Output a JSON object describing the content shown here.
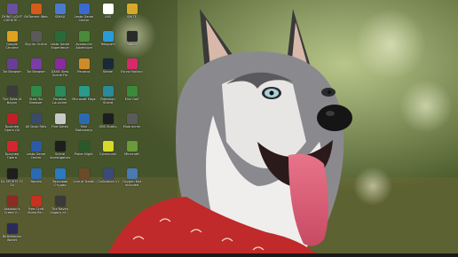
{
  "desktop": {
    "icons": [
      {
        "label": "DYING LIGHT CHRISTE...",
        "icon": "game-icon",
        "color": "#6a4fa0"
      },
      {
        "label": "Google Chrome",
        "icon": "chrome-icon",
        "color": "#e0a020"
      },
      {
        "label": "Tor Browser",
        "icon": "tor-icon",
        "color": "#6b3d99"
      },
      {
        "label": "The Tales of Bayon",
        "icon": "game-icon",
        "color": "#3c3c3c"
      },
      {
        "label": "Браузер Opera GX",
        "icon": "opera-icon",
        "color": "#c0202a"
      },
      {
        "label": "Браузер Opera",
        "icon": "opera-icon",
        "color": "#d4262e"
      },
      {
        "label": "EA SPORTS FC 24",
        "icon": "game-icon",
        "color": "#1e1e1e"
      },
      {
        "label": "Assassin's Creed V...",
        "icon": "game-icon",
        "color": "#8c2a24"
      },
      {
        "label": "BitDefender Wallet",
        "icon": "game-icon",
        "color": "#2b2b5a"
      },
      {
        "label": "BitTorrent Web",
        "icon": "torrent-icon",
        "color": "#d65a1a"
      },
      {
        "label": "Skyrim Online",
        "icon": "game-icon",
        "color": "#5a5a5a"
      },
      {
        "label": "Tor Browser",
        "icon": "tor-icon",
        "color": "#7a3da8"
      },
      {
        "label": "Start Tor Browser",
        "icon": "tor-icon",
        "color": "#2f8a4a"
      },
      {
        "label": "All Dusk Falls",
        "icon": "game-icon",
        "color": "#3a4a6a"
      },
      {
        "label": "Lesta Game Center",
        "icon": "game-icon",
        "color": "#2a5aa8"
      },
      {
        "label": "Yandex",
        "icon": "game-icon",
        "color": "#2a6ab0"
      },
      {
        "label": "Free Craft Video Re...",
        "icon": "game-icon",
        "color": "#c83020"
      },
      {
        "label": "SIMAX",
        "icon": "app-icon",
        "color": "#4a7ad0"
      },
      {
        "label": "Lesta Game Experience",
        "icon": "game-icon",
        "color": "#2a6a3a"
      },
      {
        "label": "DXVK View Scene Fix",
        "icon": "app-icon",
        "color": "#8a2aa0"
      },
      {
        "label": "Paradox Launcher",
        "icon": "app-icon",
        "color": "#2a8a5a"
      },
      {
        "label": "Five Dates",
        "icon": "game-icon",
        "color": "#c8c8c8"
      },
      {
        "label": "Scene Investigators",
        "icon": "game-icon",
        "color": "#1e1e1e"
      },
      {
        "label": "Звуковая Студия",
        "icon": "app-icon",
        "color": "#2a7ac0"
      },
      {
        "label": "The Raven Legacy of ...",
        "icon": "game-icon",
        "color": "#3a3a3a"
      },
      {
        "label": "Lesta Game Center",
        "icon": "game-icon",
        "color": "#3a6ad0"
      },
      {
        "label": "Avalanche Adventure",
        "icon": "game-icon",
        "color": "#4a8a3a"
      },
      {
        "label": "Paradox",
        "icon": "app-icon",
        "color": "#d08a2a"
      },
      {
        "label": "Microsoft Edge",
        "icon": "edge-icon",
        "color": "#2a9a8a"
      },
      {
        "label": "Mini Motorways",
        "icon": "game-icon",
        "color": "#2a6ab0"
      },
      {
        "label": "Poker Night",
        "icon": "game-icon",
        "color": "#2a5a2a"
      },
      {
        "label": "Line of Death",
        "icon": "game-icon",
        "color": "#6a4a2a"
      },
      {
        "label": "LMS",
        "icon": "app-icon",
        "color": "#ffffff"
      },
      {
        "label": "Telegram",
        "icon": "telegram-icon",
        "color": "#2a9ad8"
      },
      {
        "label": "Steam",
        "icon": "steam-icon",
        "color": "#1b2838"
      },
      {
        "label": "Pokemon Shield",
        "icon": "game-icon",
        "color": "#2a8a9a"
      },
      {
        "label": "OBS Studio",
        "icon": "obs-icon",
        "color": "#1e1e1e"
      },
      {
        "label": "Cyberpunk",
        "icon": "game-icon",
        "color": "#d8d82a"
      },
      {
        "label": "Civilization VI",
        "icon": "game-icon",
        "color": "#3a4a7a"
      },
      {
        "label": "SMITE",
        "icon": "game-icon",
        "color": "#d8a82a"
      },
      {
        "label": "Roblox",
        "icon": "roblox-icon",
        "color": "#2a2a2a"
      },
      {
        "label": "Forza Horizon",
        "icon": "game-icon",
        "color": "#d82a6a"
      },
      {
        "label": "Mini Golf",
        "icon": "game-icon",
        "color": "#3a8a3a"
      },
      {
        "label": "Mudrunner",
        "icon": "game-icon",
        "color": "#5a5a5a"
      },
      {
        "label": "Minecraft",
        "icon": "game-icon",
        "color": "#6a9a3a"
      },
      {
        "label": "Oxygen Not Included",
        "icon": "game-icon",
        "color": "#4a7ab0"
      }
    ]
  }
}
